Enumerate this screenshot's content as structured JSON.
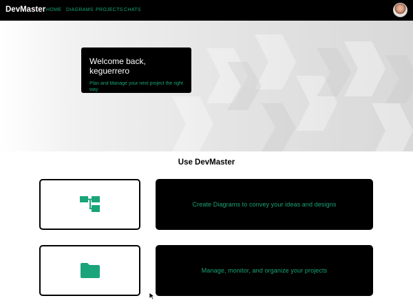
{
  "app": {
    "brand": "DevMaster"
  },
  "nav": {
    "items": [
      "HOME",
      "DIAGRAMS",
      "PROJECTS",
      "CHATS"
    ]
  },
  "hero": {
    "title": "Welcome back, keguerrero",
    "subtitle": "Plan and Manage your next project the right way"
  },
  "features": {
    "heading": "Use DevMaster",
    "items": [
      {
        "icon": "diagram-icon",
        "text": "Create Diagrams to convey your ideas and designs"
      },
      {
        "icon": "folder-icon",
        "text": "Manage, monitor, and organize your projects"
      }
    ]
  },
  "colors": {
    "accent": "#19a479",
    "dark": "#000000",
    "background": "#ffffff"
  }
}
